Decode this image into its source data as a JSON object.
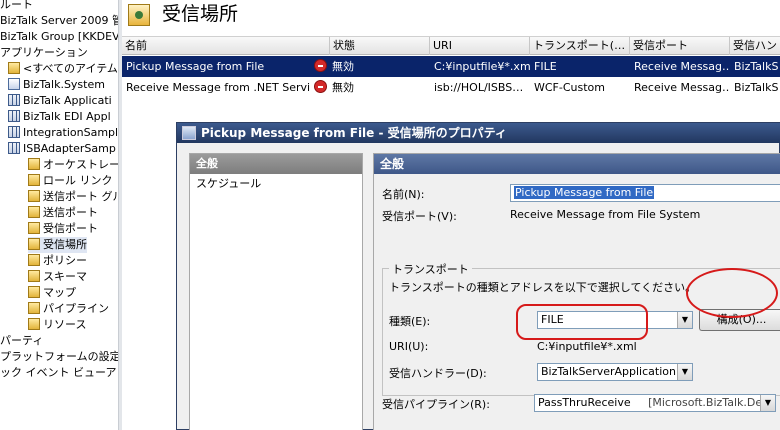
{
  "tree": {
    "items": [
      {
        "label": "ルート",
        "indent": 0,
        "icon": "none"
      },
      {
        "label": "BizTalk Server 2009 管理",
        "indent": 0,
        "icon": "none"
      },
      {
        "label": "BizTalk Group [KKDEVE",
        "indent": 0,
        "icon": "none"
      },
      {
        "label": "アプリケーション",
        "indent": 0,
        "icon": "none"
      },
      {
        "label": "<すべてのアイテム>",
        "indent": 1,
        "icon": "folder"
      },
      {
        "label": "BizTalk.System",
        "indent": 1,
        "icon": "app"
      },
      {
        "label": "BizTalk Applicati",
        "indent": 1,
        "icon": "grid"
      },
      {
        "label": "BizTalk EDI Appl",
        "indent": 1,
        "icon": "grid"
      },
      {
        "label": "IntegrationSample",
        "indent": 1,
        "icon": "grid"
      },
      {
        "label": "ISBAdapterSamp",
        "indent": 1,
        "icon": "grid"
      },
      {
        "label": "オーケストレーシ",
        "indent": 2,
        "icon": "folder"
      },
      {
        "label": "ロール リンク",
        "indent": 2,
        "icon": "folder"
      },
      {
        "label": "送信ポート グル",
        "indent": 2,
        "icon": "folder"
      },
      {
        "label": "送信ポート",
        "indent": 2,
        "icon": "folder"
      },
      {
        "label": "受信ポート",
        "indent": 2,
        "icon": "folder"
      },
      {
        "label": "受信場所",
        "indent": 2,
        "icon": "sel"
      },
      {
        "label": "ポリシー",
        "indent": 2,
        "icon": "folder"
      },
      {
        "label": "スキーマ",
        "indent": 2,
        "icon": "folder"
      },
      {
        "label": "マップ",
        "indent": 2,
        "icon": "folder"
      },
      {
        "label": "パイプライン",
        "indent": 2,
        "icon": "folder"
      },
      {
        "label": "リソース",
        "indent": 2,
        "icon": "folder"
      },
      {
        "label": "パーティ",
        "indent": 0,
        "icon": "none"
      },
      {
        "label": "プラットフォームの設定",
        "indent": 0,
        "icon": "none"
      },
      {
        "label": "ック イベント ビューア (ロー",
        "indent": 0,
        "icon": "none"
      }
    ]
  },
  "main": {
    "title": "受信場所",
    "columns": [
      "名前",
      "状態",
      "URI",
      "トランスポート(…",
      "受信ポート",
      "受信ハン"
    ],
    "rows": [
      {
        "name": "Pickup Message from File",
        "status": "無効",
        "uri": "C:¥inputfile¥*.xml",
        "transport": "FILE",
        "port": "Receive Messag…",
        "handler": "BizTalkS"
      },
      {
        "name": "Receive Message from .NET Servi…",
        "status": "無効",
        "uri": "isb://HOL/ISBS…",
        "transport": "WCF-Custom",
        "port": "Receive Messag…",
        "handler": "BizTalkS"
      }
    ]
  },
  "dialog": {
    "title": "Pickup Message from File - 受信場所のプロパティ",
    "nav": [
      "全般",
      "スケジュール"
    ],
    "panel_title": "全般",
    "name_label": "名前(N):",
    "name_value": "Pickup Message from File",
    "receive_port_label": "受信ポート(V):",
    "receive_port_value": "Receive Message from File System",
    "transport_group": "トランスポート",
    "transport_desc": "トランスポートの種類とアドレスを以下で選択してください。",
    "type_label": "種類(E):",
    "type_value": "FILE",
    "configure_button": "構成(O)...",
    "uri_label": "URI(U):",
    "uri_value": "C:¥inputfile¥*.xml",
    "handler_label": "受信ハンドラー(D):",
    "handler_value": "BizTalkServerApplication",
    "pipeline_label": "受信パイプライン(R):",
    "pipeline_value": "PassThruReceive",
    "pipeline_extra": "[Microsoft.BizTalk.De"
  },
  "colors": {
    "selection": "#0a246a",
    "dialog_title": "#2d4470",
    "annotation": "#d61a1a"
  }
}
